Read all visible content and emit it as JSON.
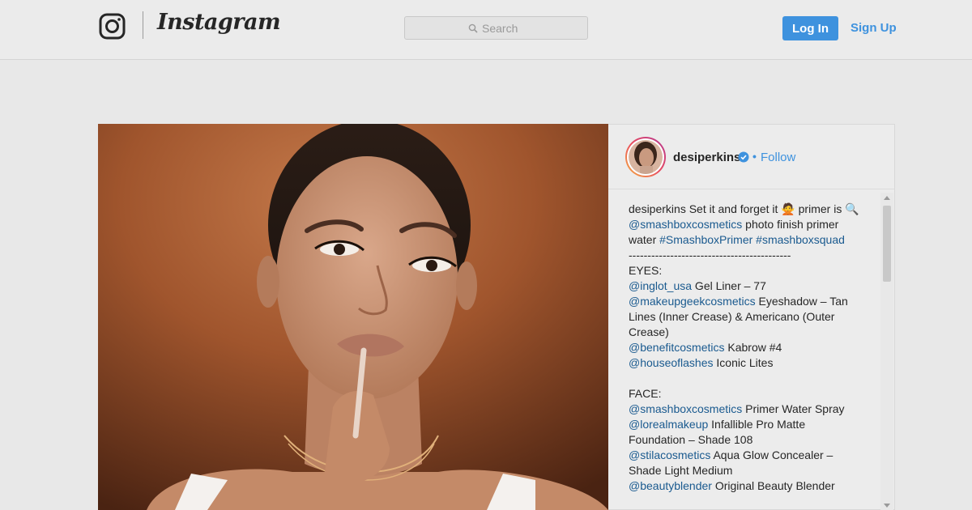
{
  "header": {
    "brand": "Instagram",
    "search_placeholder": "Search",
    "login_label": "Log In",
    "signup_label": "Sign Up",
    "icons": {
      "logo": "instagram-camera-icon",
      "search": "search-icon"
    },
    "colors": {
      "accent": "#3e92de",
      "background": "#ebebeb"
    }
  },
  "post": {
    "username": "desiperkins",
    "verified": true,
    "follow_label": "Follow",
    "separator": "•",
    "photo_description_icon": "post-photo",
    "caption": [
      [
        {
          "t": "text",
          "v": "desiperkins Set it and forget it 🙅 primer is 🔍"
        }
      ],
      [
        {
          "t": "mention",
          "v": "@smashboxcosmetics"
        },
        {
          "t": "text",
          "v": " photo finish primer water "
        },
        {
          "t": "tag",
          "v": "#SmashboxPrimer"
        },
        {
          "t": "text",
          "v": "  "
        },
        {
          "t": "tag",
          "v": "#smashboxsquad"
        }
      ],
      [
        {
          "t": "text",
          "v": "-------------------------------------------"
        }
      ],
      [
        {
          "t": "text",
          "v": "EYES:"
        }
      ],
      [
        {
          "t": "mention",
          "v": "@inglot_usa"
        },
        {
          "t": "text",
          "v": " Gel Liner – 77"
        }
      ],
      [
        {
          "t": "mention",
          "v": "@makeupgeekcosmetics"
        },
        {
          "t": "text",
          "v": " Eyeshadow – Tan Lines (Inner Crease) & Americano (Outer Crease)"
        }
      ],
      [
        {
          "t": "mention",
          "v": "@benefitcosmetics"
        },
        {
          "t": "text",
          "v": " Kabrow #4"
        }
      ],
      [
        {
          "t": "mention",
          "v": "@houseoflashes"
        },
        {
          "t": "text",
          "v": " Iconic Lites"
        }
      ],
      [
        {
          "t": "text",
          "v": ""
        }
      ],
      [
        {
          "t": "text",
          "v": "FACE:"
        }
      ],
      [
        {
          "t": "mention",
          "v": "@smashboxcosmetics"
        },
        {
          "t": "text",
          "v": " Primer Water Spray"
        }
      ],
      [
        {
          "t": "mention",
          "v": "@lorealmakeup"
        },
        {
          "t": "text",
          "v": " Infallible Pro Matte Foundation – Shade 108"
        }
      ],
      [
        {
          "t": "mention",
          "v": "@stilacosmetics"
        },
        {
          "t": "text",
          "v": " Aqua Glow Concealer – Shade Light Medium"
        }
      ],
      [
        {
          "t": "mention",
          "v": "@beautyblender"
        },
        {
          "t": "text",
          "v": " Original Beauty Blender"
        }
      ]
    ]
  }
}
